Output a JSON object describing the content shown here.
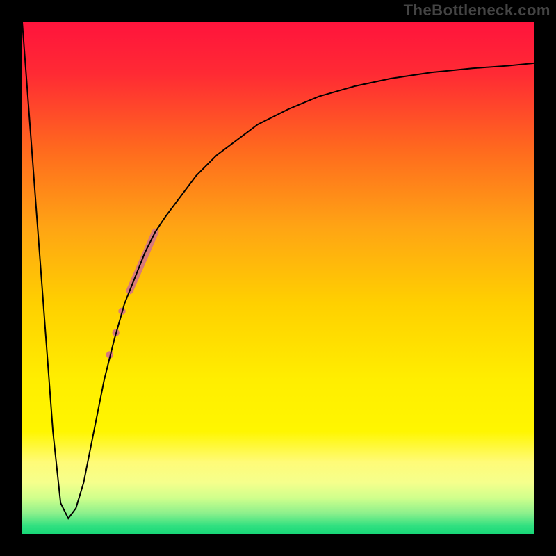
{
  "watermark": "TheBottleneck.com",
  "gradient_stops": [
    {
      "offset": 0.0,
      "color": "#ff143c"
    },
    {
      "offset": 0.1,
      "color": "#ff2a34"
    },
    {
      "offset": 0.25,
      "color": "#ff6a1e"
    },
    {
      "offset": 0.4,
      "color": "#ffa414"
    },
    {
      "offset": 0.55,
      "color": "#ffd000"
    },
    {
      "offset": 0.7,
      "color": "#ffee00"
    },
    {
      "offset": 0.8,
      "color": "#fff600"
    },
    {
      "offset": 0.86,
      "color": "#fffb78"
    },
    {
      "offset": 0.9,
      "color": "#f5ff8c"
    },
    {
      "offset": 0.93,
      "color": "#d0ff8c"
    },
    {
      "offset": 0.96,
      "color": "#8cf08c"
    },
    {
      "offset": 0.985,
      "color": "#30e080"
    },
    {
      "offset": 1.0,
      "color": "#18d878"
    }
  ],
  "chart_data": {
    "type": "line",
    "title": "",
    "xlabel": "",
    "ylabel": "",
    "xlim": [
      0,
      100
    ],
    "ylim": [
      0,
      100
    ],
    "series": [
      {
        "name": "curve",
        "x": [
          0,
          3,
          6,
          7.5,
          9,
          10.5,
          12,
          14,
          16,
          18,
          20,
          22,
          24,
          26,
          28,
          31,
          34,
          38,
          42,
          46,
          52,
          58,
          65,
          72,
          80,
          88,
          95,
          100
        ],
        "y": [
          100,
          60,
          20,
          6,
          3,
          5,
          10,
          20,
          30,
          38,
          45,
          50,
          55,
          59,
          62,
          66,
          70,
          74,
          77,
          80,
          83,
          85.5,
          87.5,
          89,
          90.2,
          91,
          91.5,
          92
        ]
      }
    ],
    "markers": [
      {
        "shape": "segment",
        "x1": 21.0,
        "y1": 47.5,
        "x2": 26.0,
        "y2": 59.0,
        "width": 10,
        "color": "#d77a7a"
      },
      {
        "shape": "circle",
        "cx": 19.5,
        "cy": 43.5,
        "r": 5.2,
        "color": "#d77a7a"
      },
      {
        "shape": "circle",
        "cx": 18.3,
        "cy": 39.3,
        "r": 5.2,
        "color": "#d77a7a"
      },
      {
        "shape": "circle",
        "cx": 17.1,
        "cy": 35.0,
        "r": 5.2,
        "color": "#d77a7a"
      }
    ]
  }
}
